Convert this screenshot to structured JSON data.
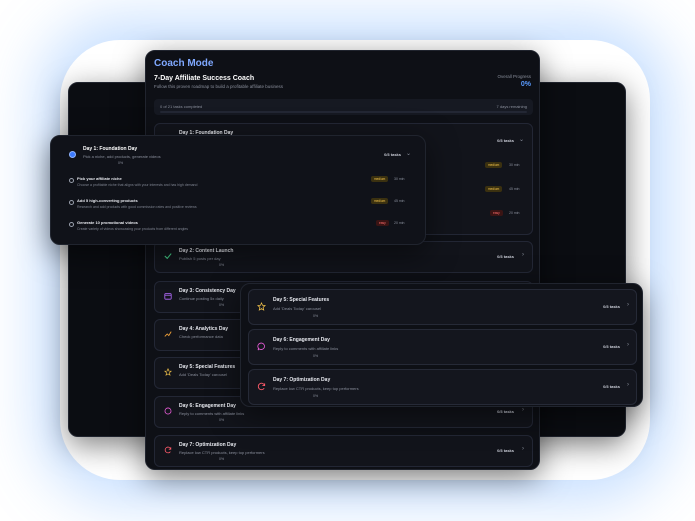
{
  "app": {
    "mode_title": "Coach Mode",
    "heading": "7-Day Affiliate Success Coach",
    "subheading": "Follow this proven roadmap to build a profitable affiliate business",
    "overall_label": "Overall Progress",
    "overall_value": "0%",
    "progress_left": "0 of 21 tasks completed",
    "progress_right": "7 days remaining"
  },
  "focused_day": {
    "title": "Day 1: Foundation Day",
    "desc": "Pick a niche, add products, generate videos",
    "pct": "0%",
    "tasks": "0/3 tasks",
    "items": [
      {
        "title": "Pick your affiliate niche",
        "desc": "Choose a profitable niche that aligns with your interests and has high demand",
        "level": "medium",
        "time": "30 min"
      },
      {
        "title": "Add 5 high-converting products",
        "desc": "Research and add products with good commission rates and positive reviews",
        "level": "medium",
        "time": "45 min"
      },
      {
        "title": "Generate 10 promotional videos",
        "desc": "Create variety of videos showcasing your products from different angles",
        "level": "easy",
        "time": "20 min"
      }
    ]
  },
  "behind_day1": {
    "title": "Day 1: Foundation Day",
    "tasks": "0/3 tasks",
    "items": [
      {
        "level": "medium",
        "time": "30 min"
      },
      {
        "level": "medium",
        "time": "45 min"
      },
      {
        "level": "easy",
        "time": "20 min"
      }
    ]
  },
  "main_days": [
    {
      "title": "Day 2: Content Launch",
      "desc": "Publish 5 posts per day",
      "pct": "0%",
      "tasks": "0/3 tasks"
    },
    {
      "title": "Day 3: Consistency Day",
      "desc": "Continue posting 5x daily",
      "pct": "0%",
      "tasks": "0/3 tasks"
    },
    {
      "title": "Day 4: Analytics Day",
      "desc": "Check performance data",
      "pct": "0%",
      "tasks": "0/3 tasks"
    },
    {
      "title": "Day 5: Special Features",
      "desc": "Add 'Deals Today' carousel",
      "pct": "0%",
      "tasks": "0/3 tasks"
    },
    {
      "title": "Day 6: Engagement Day",
      "desc": "Reply to comments with affiliate links",
      "pct": "0%",
      "tasks": "0/3 tasks"
    },
    {
      "title": "Day 7: Optimization Day",
      "desc": "Replace low CTR products, keep top performers",
      "pct": "0%",
      "tasks": "0/3 tasks"
    }
  ],
  "front_days": [
    {
      "title": "Day 5: Special Features",
      "desc": "Add 'Deals Today' carousel",
      "pct": "0%",
      "tasks": "0/3 tasks",
      "icon": "star-icon",
      "color": "#f2c24a"
    },
    {
      "title": "Day 6: Engagement Day",
      "desc": "Reply to comments with affiliate links",
      "pct": "0%",
      "tasks": "0/3 tasks",
      "icon": "chat-icon",
      "color": "#e65bd6"
    },
    {
      "title": "Day 7: Optimization Day",
      "desc": "Replace low CTR products, keep top performers",
      "pct": "0%",
      "tasks": "0/3 tasks",
      "icon": "refresh-icon",
      "color": "#ff5a6a"
    }
  ],
  "colors": {
    "accent": "#5a9bff",
    "bg": "#0e1016",
    "medium": "#f2c24a",
    "easy": "#ff6b6b"
  }
}
